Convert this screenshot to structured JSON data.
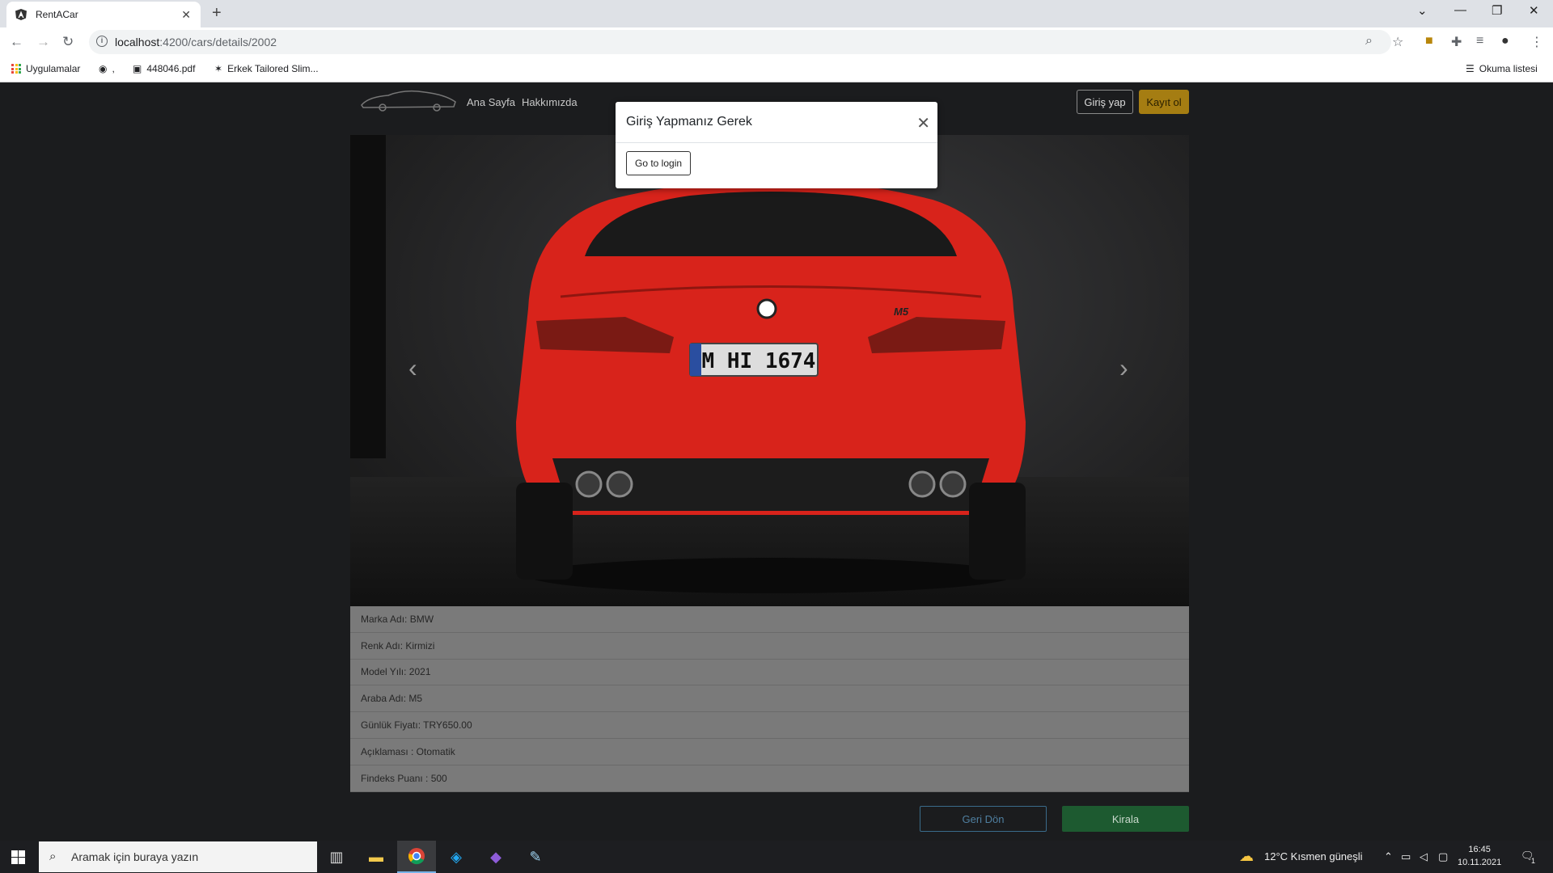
{
  "browser": {
    "tab_title": "RentACar",
    "url_host": "localhost",
    "url_path": ":4200/cars/details/2002",
    "bookmarks": [
      "Uygulamalar",
      ",",
      "448046.pdf",
      "Erkek Tailored Slim..."
    ],
    "reading_list": "Okuma listesi"
  },
  "nav": {
    "links": [
      "Ana Sayfa",
      "Hakkımızda"
    ],
    "login_label": "Giriş yap",
    "register_label": "Kayıt ol"
  },
  "modal": {
    "title": "Giriş Yapmanız Gerek",
    "button_label": "Go to login"
  },
  "car_image": {
    "plate": "M HI 1674",
    "badge": "M5"
  },
  "details": [
    "Marka Adı: BMW",
    "Renk Adı: Kirmizi",
    "Model Yılı: 2021",
    "Araba Adı: M5",
    "Günlük Fiyatı: TRY650.00",
    "Açıklaması : Otomatik",
    "Findeks Puanı : 500"
  ],
  "actions": {
    "back_label": "Geri Dön",
    "rent_label": "Kirala"
  },
  "taskbar": {
    "search_placeholder": "Aramak için buraya yazın",
    "weather": "12°C  Kısmen güneşli",
    "time": "16:45",
    "date": "10.11.2021",
    "notifications": "1"
  },
  "colors": {
    "accent_register": "#a57d12",
    "rent_button": "#1d5a30",
    "car_red": "#d8231b"
  }
}
